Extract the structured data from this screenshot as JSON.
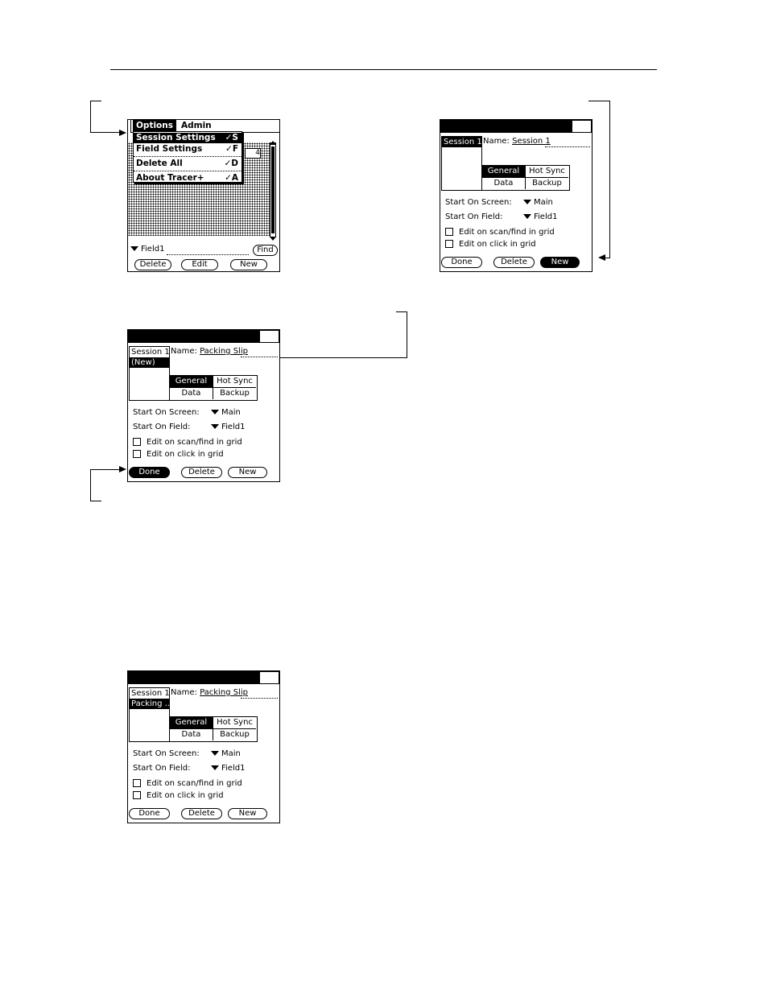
{
  "menu_screen": {
    "menus": [
      "Options",
      "Admin"
    ],
    "items": [
      {
        "label": "Session Settings",
        "shortcut": "✓S"
      },
      {
        "label": "Field Settings",
        "shortcut": "✓F"
      },
      {
        "label": "Delete All",
        "shortcut": "✓D"
      },
      {
        "label": "About Tracer+",
        "shortcut": "✓A"
      }
    ],
    "field_select": "Field1",
    "find_button": "Find",
    "buttons": [
      "Delete",
      "Edit",
      "New"
    ]
  },
  "settings_common": {
    "name_label": "Name:",
    "tabs": [
      "General",
      "Hot Sync",
      "Data",
      "Backup"
    ],
    "start_screen_label": "Start On Screen:",
    "start_screen_value": "Main",
    "start_field_label": "Start On Field:",
    "start_field_value": "Field1",
    "checkbox1": "Edit on scan/find in grid",
    "checkbox2": "Edit on click in grid",
    "buttons": [
      "Done",
      "Delete",
      "New"
    ]
  },
  "screen2": {
    "list": [
      "Session 1"
    ],
    "name_value": "Session 1"
  },
  "screen3": {
    "list": [
      "Session 1",
      "(New)"
    ],
    "name_value": "Packing Slip"
  },
  "screen4": {
    "list": [
      "Session 1",
      "Packing ..."
    ],
    "name_value": "Packing Slip"
  }
}
